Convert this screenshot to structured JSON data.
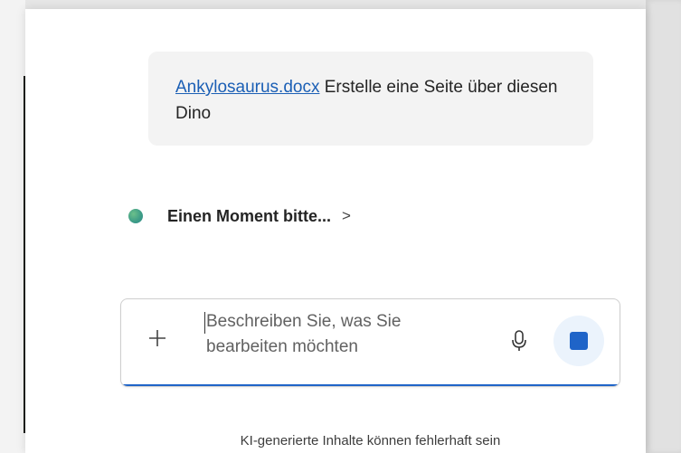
{
  "chat": {
    "user_message": {
      "file_link": "Ankylosaurus.docx",
      "text": " Erstelle eine Seite über diesen Dino"
    },
    "status": {
      "text": "Einen Moment bitte...",
      "chevron": ">"
    }
  },
  "composer": {
    "placeholder": "Beschreiben Sie, was Sie bearbeiten möchten",
    "add_icon": "plus-icon",
    "mic_icon": "microphone-icon",
    "stop_icon": "stop-icon"
  },
  "footer": {
    "disclaimer": "KI-generierte Inhalte können fehlerhaft sein"
  },
  "colors": {
    "accent": "#1f64c8",
    "link": "#1b5fb5",
    "bubble": "#f3f3f3"
  }
}
